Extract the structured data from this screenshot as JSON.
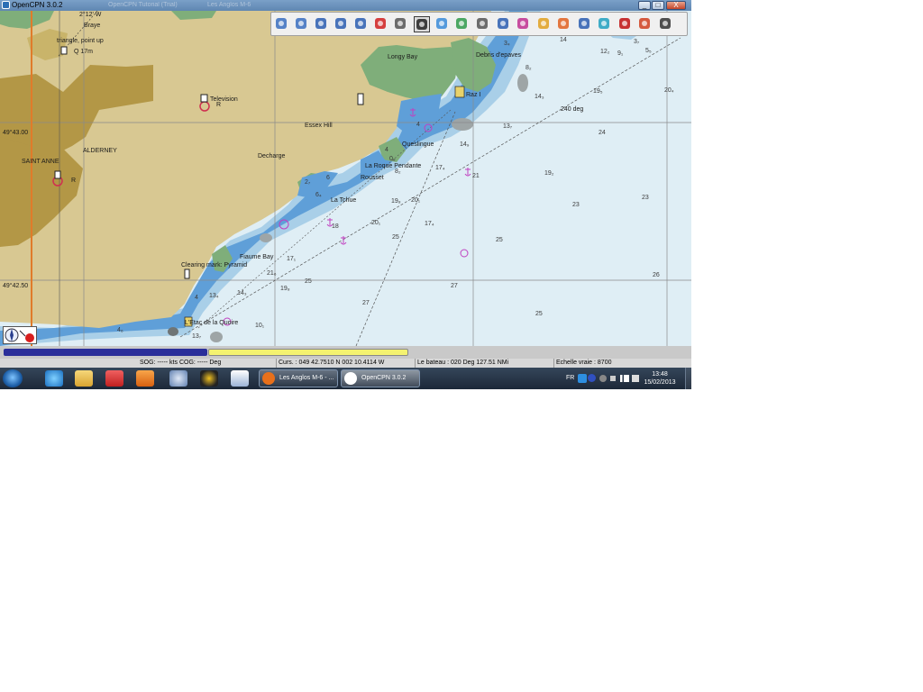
{
  "window": {
    "title": "OpenCPN 3.0.2",
    "ghost_titles": [
      "OpenCPN Tutorial (Trial)",
      "Les Anglos M-6"
    ],
    "controls": [
      "_",
      "□",
      "X"
    ]
  },
  "chart": {
    "labels": {
      "longitude_top": "2°12' W",
      "braye": "Braye",
      "triangle": "triangle, point up",
      "q17m": "Q 17m",
      "television": "Television",
      "tv_r": "R",
      "alderney": "ALDERNEY",
      "saint_anne": "SAINT ANNE",
      "sa_r": "R",
      "lat_4300": "49°43.00",
      "lat_4250": "49°42.50",
      "essex_hill": "Essex Hill",
      "decharge": "Decharge",
      "longy_bay": "Longy Bay",
      "debris": "Debris d'epaves",
      "raz": "Raz I",
      "heading": "240 deg",
      "queslingue": "Queslingue",
      "roque": "La Roque Pendante",
      "rousset": "Rousset",
      "la_tchue": "La Tchue",
      "fiaume": "Fiaume Bay",
      "clearing": "Clearing mark: Pyramid",
      "etac": "L'Etac de la Quoire"
    },
    "depths": [
      {
        "v": "14"
      },
      {
        "v": "12₂"
      },
      {
        "v": "9₁"
      },
      {
        "v": "5₅"
      },
      {
        "v": "3₇"
      },
      {
        "v": "3₄"
      },
      {
        "v": "8₂"
      },
      {
        "v": "19₅"
      },
      {
        "v": "20₄"
      },
      {
        "v": "14₃"
      },
      {
        "v": "13₇"
      },
      {
        "v": "24"
      },
      {
        "v": "14₉"
      },
      {
        "v": "17₄"
      },
      {
        "v": "19₂"
      },
      {
        "v": "21"
      },
      {
        "v": "23"
      },
      {
        "v": "23"
      },
      {
        "v": "19₈"
      },
      {
        "v": "20₁"
      },
      {
        "v": "20₁"
      },
      {
        "v": "17₄"
      },
      {
        "v": "25"
      },
      {
        "v": "25"
      },
      {
        "v": "17₁"
      },
      {
        "v": "21₆"
      },
      {
        "v": "25"
      },
      {
        "v": "19₈"
      },
      {
        "v": "27"
      },
      {
        "v": "26"
      },
      {
        "v": "13₄"
      },
      {
        "v": "14₃"
      },
      {
        "v": "27"
      },
      {
        "v": "10₁"
      },
      {
        "v": "25"
      },
      {
        "v": "4₆"
      },
      {
        "v": "13₇"
      },
      {
        "v": "0₉"
      },
      {
        "v": "6₄"
      },
      {
        "v": "2₇"
      },
      {
        "v": "8₂"
      },
      {
        "v": "4"
      },
      {
        "v": "4"
      },
      {
        "v": "4"
      },
      {
        "v": "6"
      },
      {
        "v": "18"
      }
    ]
  },
  "toolbar": {
    "buttons": [
      {
        "name": "zoom-in-icon",
        "color": "#3a6fc0"
      },
      {
        "name": "zoom-out-icon",
        "color": "#3a6fc0"
      },
      {
        "name": "scale-in-icon",
        "color": "#2a5db0"
      },
      {
        "name": "scale-out-icon",
        "color": "#2a5db0"
      },
      {
        "name": "route-icon",
        "color": "#2a5db0"
      },
      {
        "name": "follow-icon",
        "color": "#d02020"
      },
      {
        "name": "settings-icon",
        "color": "#555555"
      },
      {
        "name": "text-icon",
        "color": "#222222",
        "active": true
      },
      {
        "name": "current-icon",
        "color": "#3a8bd8"
      },
      {
        "name": "tide-icon",
        "color": "#2f9a4a"
      },
      {
        "name": "print-icon",
        "color": "#555555"
      },
      {
        "name": "route-manager-icon",
        "color": "#2a5db0"
      },
      {
        "name": "track-icon",
        "color": "#c03090"
      },
      {
        "name": "color-scheme-icon",
        "color": "#e0a020"
      },
      {
        "name": "mob-icon",
        "color": "#e06020"
      },
      {
        "name": "help-icon",
        "color": "#2a5db0"
      },
      {
        "name": "plugin-icon",
        "color": "#20a0c0"
      },
      {
        "name": "record-icon",
        "color": "#c01010"
      },
      {
        "name": "ais-icon",
        "color": "#d04020"
      },
      {
        "name": "menu-icon",
        "color": "#333333"
      }
    ]
  },
  "progress": {
    "blue_fraction": 0.295,
    "yellow_fraction": 0.29
  },
  "status": {
    "sog": "SOG: ----- kts  COG: ----- Deg",
    "cursor": "Curs. : 049 42.7510 N 002 10.4114 W",
    "boat": "Le  bateau : 020 Deg  127.51 NMi",
    "scale": "Echelle vraie :      8700"
  },
  "taskbar": {
    "tasks": [
      {
        "label": "Les Anglos M-6 - ...",
        "icon_color": "#e8701a"
      },
      {
        "label": "OpenCPN 3.0.2",
        "icon_color": "#ffffff"
      }
    ],
    "lang": "FR",
    "time": "13:48",
    "date": "15/02/2013"
  }
}
